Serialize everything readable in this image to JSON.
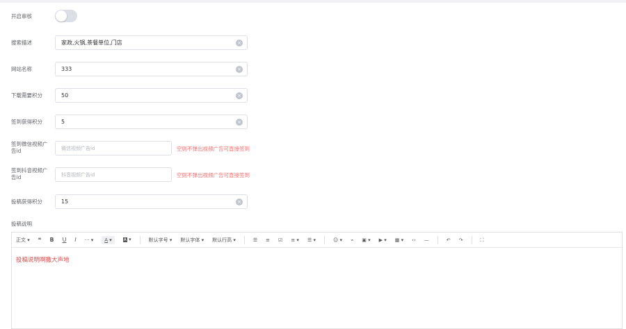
{
  "fields": {
    "enable_review": {
      "label": "开启审核",
      "value": false
    },
    "search_desc": {
      "label": "搜索描述",
      "value": "家政,火锅,茶餐单位,门店"
    },
    "site_name": {
      "label": "网站名称",
      "value": "333"
    },
    "download_points": {
      "label": "下载需要积分",
      "value": "50"
    },
    "signin_points": {
      "label": "签到获得积分",
      "value": "5"
    },
    "signin_wechat_ad": {
      "label_line1": "签到微信视频广",
      "label_line2": "告id",
      "placeholder": "微信视频广告id",
      "hint": "空则不弹出视频广告可直接签到"
    },
    "signin_douyin_ad": {
      "label_line1": "签到抖音视频广",
      "label_line2": "告id",
      "placeholder": "抖音视频广告id",
      "hint": "空则不弹出视频广告可直接签到"
    },
    "submit_points": {
      "label": "投稿获得积分",
      "value": "15"
    },
    "submit_guide": {
      "label": "投稿说明"
    }
  },
  "editor": {
    "toolbar": {
      "paragraph": "正文",
      "quote": "❝",
      "bold": "B",
      "underline": "U",
      "italic": "I",
      "more": "···",
      "font_color": "A",
      "bg_color": "A",
      "font_size": "默认字号",
      "font_family": "默认字体",
      "line_height": "默认行高",
      "bullet_list": "☰",
      "number_list": "≡",
      "todo": "☑",
      "align": "≡",
      "indent": "☰",
      "emoji": "☺",
      "link": "🔗",
      "image": "▣",
      "video": "▶",
      "table": "▦",
      "code": "‹›",
      "divider": "—",
      "undo": "↶",
      "redo": "↷",
      "fullscreen": "⛶"
    },
    "content": "投稿说明啊撒大声地"
  }
}
